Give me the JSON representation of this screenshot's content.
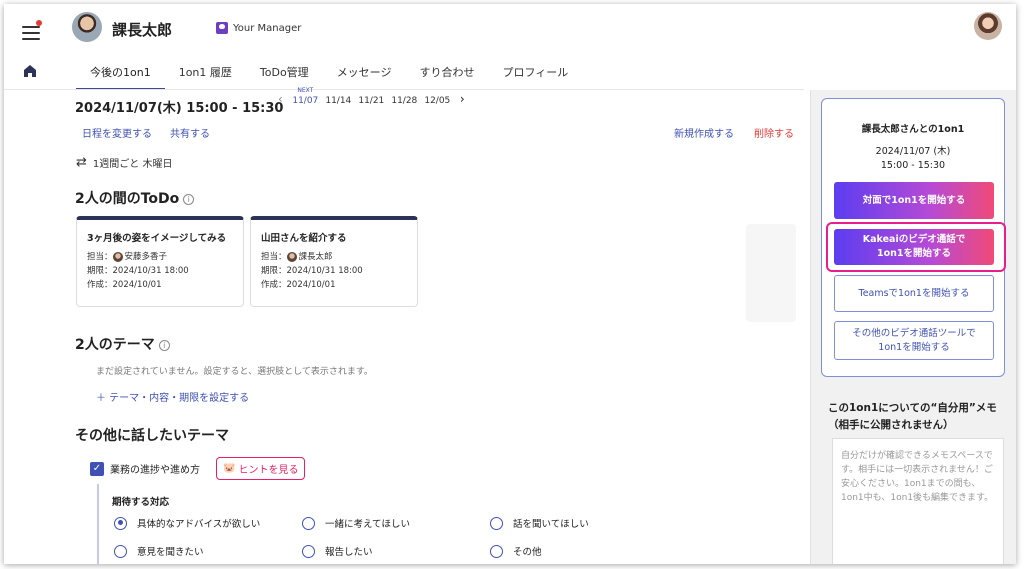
{
  "header": {
    "user_name": "課長太郎",
    "manager_label": "Your Manager"
  },
  "tabs": [
    {
      "label": "今後の1on1"
    },
    {
      "label": "1on1 履歴"
    },
    {
      "label": "ToDo管理"
    },
    {
      "label": "メッセージ"
    },
    {
      "label": "すり合わせ"
    },
    {
      "label": "プロフィール"
    }
  ],
  "meeting": {
    "date_time": "2024/11/07(木)  15:00 - 15:30",
    "next_label": "NEXT",
    "dates": [
      "11/07",
      "11/14",
      "11/21",
      "11/28",
      "12/05"
    ],
    "change_schedule": "日程を変更する",
    "share": "共有する",
    "new_create": "新規作成する",
    "delete": "削除する",
    "repeat": "1週間ごと 木曜日"
  },
  "todo_section": {
    "title": "2人の間のToDo",
    "cards": [
      {
        "title": "3ヶ月後の姿をイメージしてみる",
        "assignee": "担当：",
        "assignee_name": "安藤多香子",
        "due": "期限：2024/10/31 18:00",
        "created": "作成：2024/10/01"
      },
      {
        "title": "山田さんを紹介する",
        "assignee": "担当：",
        "assignee_name": "課長太郎",
        "due": "期限：2024/10/31 18:00",
        "created": "作成：2024/10/01"
      }
    ]
  },
  "theme_section": {
    "title": "2人のテーマ",
    "note": "まだ設定されていません。設定すると、選択肢として表示されます。",
    "add_link": "＋  テーマ・内容・期限を設定する"
  },
  "other_section": {
    "title": "その他に話したいテーマ",
    "checkbox_label": "業務の進捗や進め方",
    "hint_button": "ヒントを見る",
    "expect_label": "期待する対応",
    "options": [
      {
        "label": "具体的なアドバイスが欲しい",
        "selected": true
      },
      {
        "label": "一緒に考えてほしい",
        "selected": false
      },
      {
        "label": "話を聞いてほしい",
        "selected": false
      },
      {
        "label": "意見を聞きたい",
        "selected": false
      },
      {
        "label": "報告したい",
        "selected": false
      },
      {
        "label": "その他",
        "selected": false
      }
    ]
  },
  "side_panel": {
    "title": "課長太郎さんとの1on1",
    "date": "2024/11/07 (木)",
    "time": "15:00 - 15:30",
    "btn_face": "対面で1on1を開始する",
    "btn_kakeai_1": "Kakeaiのビデオ通話で",
    "btn_kakeai_2": "1on1を開始する",
    "btn_teams": "Teamsで1on1を開始する",
    "btn_other_1": "その他のビデオ通話ツールで",
    "btn_other_2": "1on1を開始する",
    "memo_title_1": "この1on1についての“自分用”メモ",
    "memo_title_2": "（相手に公開されません）",
    "memo_placeholder": "自分だけが確認できるメモスペースです。相手には一切表示されません！ご安心ください。1on1までの間も、1on1中も、1on1後も編集できます。"
  },
  "colors": {
    "accent": "#3f51b5",
    "danger": "#e53935",
    "highlight": "#e91e8c",
    "card_top": "#2d3259"
  }
}
